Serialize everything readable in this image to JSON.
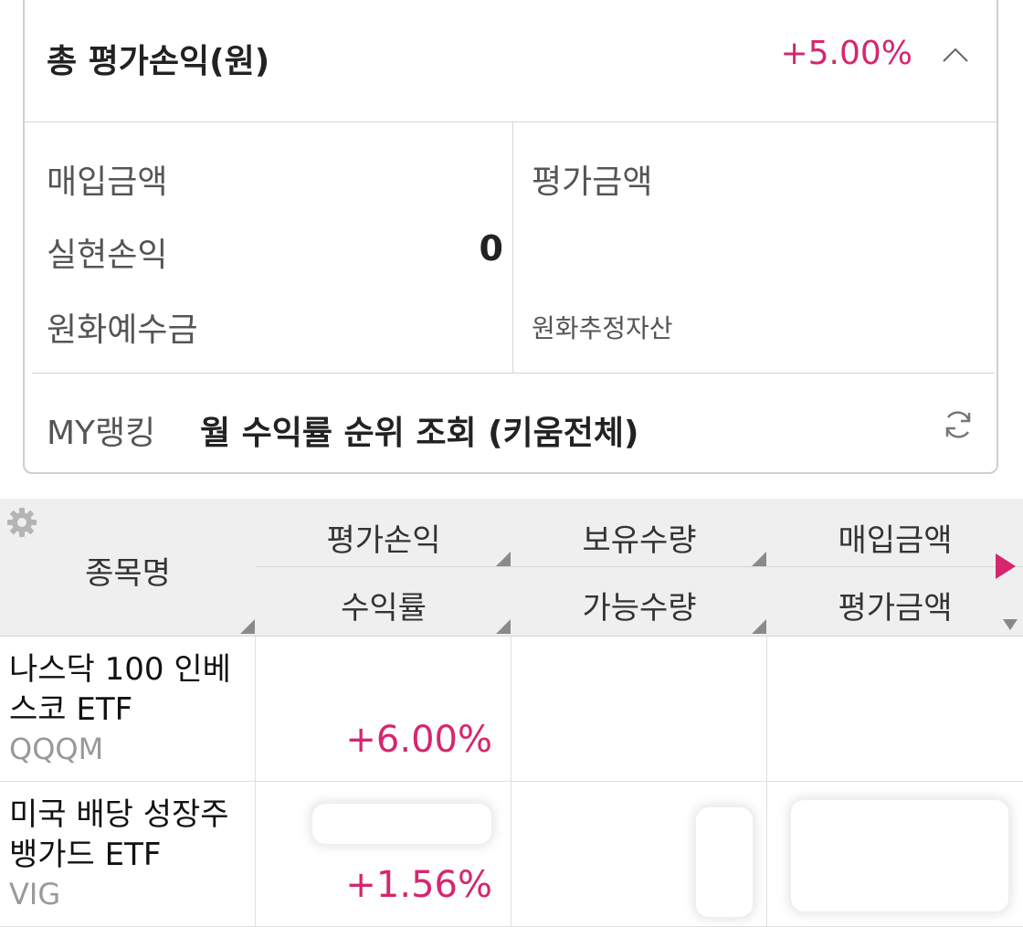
{
  "summary": {
    "title": "총 평가손익(원)",
    "total_rate": "+5.00%",
    "purchase_amount_label": "매입금액",
    "eval_amount_label": "평가금액",
    "realized_pl_label": "실현손익",
    "realized_pl_value": "0",
    "krw_deposit_label": "원화예수금",
    "krw_estimated_assets_label": "원화추정자산",
    "my_ranking_label": "MY랭킹",
    "ranking_link": "월 수익률 순위 조회 (키움전체)"
  },
  "table": {
    "headers": {
      "name": "종목명",
      "eval_pl": "평가손익",
      "holding_qty": "보유수량",
      "purchase_amount": "매입금액",
      "return_rate": "수익률",
      "available_qty": "가능수량",
      "eval_amount": "평가금액"
    },
    "rows": [
      {
        "name": "나스닥 100 인베스코 ETF",
        "ticker": "QQQM",
        "return_rate": "+6.00%"
      },
      {
        "name": "미국 배당 성장주 뱅가드 ETF",
        "ticker": "VIG",
        "return_rate": "+1.56%"
      }
    ]
  },
  "colors": {
    "accent": "#d6266f",
    "header_bg": "#efefef",
    "border": "#d6d6d6"
  },
  "icons": [
    "chevron-up-icon",
    "refresh-icon",
    "gear-icon",
    "scroll-right-icon",
    "scroll-down-icon",
    "sort-icon"
  ]
}
